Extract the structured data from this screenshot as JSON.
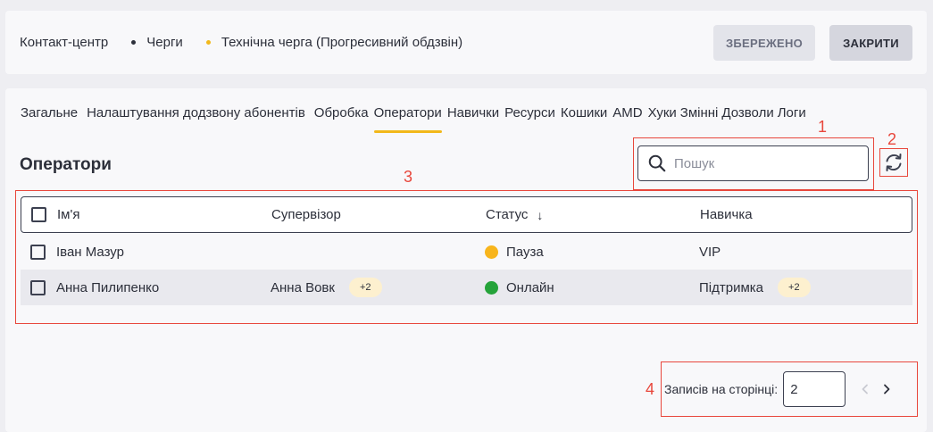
{
  "header": {
    "breadcrumbs": [
      "Контакт-центр",
      "Черги",
      "Технічна черга (Прогресивний обдзвін)"
    ],
    "saved_label": "ЗБЕРЕЖЕНО",
    "close_label": "ЗАКРИТИ"
  },
  "tabs": [
    "Загальне",
    "Налаштування додзвону абонентів",
    "Обробка",
    "Оператори",
    "Навички",
    "Ресурси",
    "Кошики",
    "AMD",
    "Хуки",
    "Змінні",
    "Дозволи",
    "Логи"
  ],
  "active_tab": "Оператори",
  "section_title": "Оператори",
  "search": {
    "placeholder": "Пошук"
  },
  "table": {
    "headers": {
      "name": "Ім'я",
      "supervisor": "Супервізор",
      "status": "Статус",
      "skill": "Навичка"
    },
    "sort_indicator": "↓",
    "rows": [
      {
        "name": "Іван Мазур",
        "supervisor": "",
        "supervisor_extra": "",
        "status": "Пауза",
        "status_color": "#f8b51c",
        "skill": "VIP",
        "skill_extra": ""
      },
      {
        "name": "Анна Пилипенко",
        "supervisor": "Анна Вовк",
        "supervisor_extra": "+2",
        "status": "Онлайн",
        "status_color": "#25a33a",
        "skill": "Підтримка",
        "skill_extra": "+2"
      }
    ]
  },
  "pagination": {
    "label": "Записів на сторінці:",
    "per_page": "2"
  },
  "annotations": {
    "m1": "1",
    "m2": "2",
    "m3": "3",
    "m4": "4"
  },
  "colors": {
    "accent": "#f2b81b",
    "annotation": "#e8473c"
  }
}
